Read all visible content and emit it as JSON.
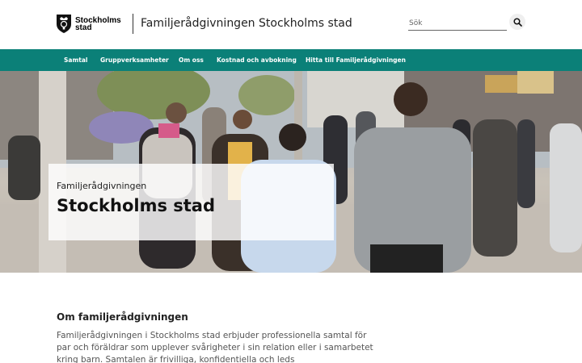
{
  "header": {
    "logo_line1": "Stockholms",
    "logo_line2": "stad",
    "site_title": "Familjerådgivningen Stockholms stad",
    "search_placeholder": "Sök"
  },
  "nav": {
    "items": [
      {
        "label": "Samtal"
      },
      {
        "label": "Gruppverksamheter"
      },
      {
        "label": "Om oss"
      },
      {
        "label": "Kostnad och avbokning"
      },
      {
        "label": "Hitta till Familjerådgivningen"
      }
    ]
  },
  "hero": {
    "kicker": "Familjerådgivningen",
    "title": "Stockholms stad"
  },
  "content": {
    "heading": "Om familjerådgivningen",
    "body": "Familjerådgivningen i Stockholms stad erbjuder professionella samtal för par och föräldrar som upplever svårigheter i sin relation eller i samarbetet kring barn. Samtalen är frivilliga, konfidentiella och leds"
  },
  "colors": {
    "nav_bg": "#0b8078",
    "text": "#333333"
  },
  "icons": {
    "logo": "stockholm-crown-shield-icon",
    "search": "search-icon"
  }
}
